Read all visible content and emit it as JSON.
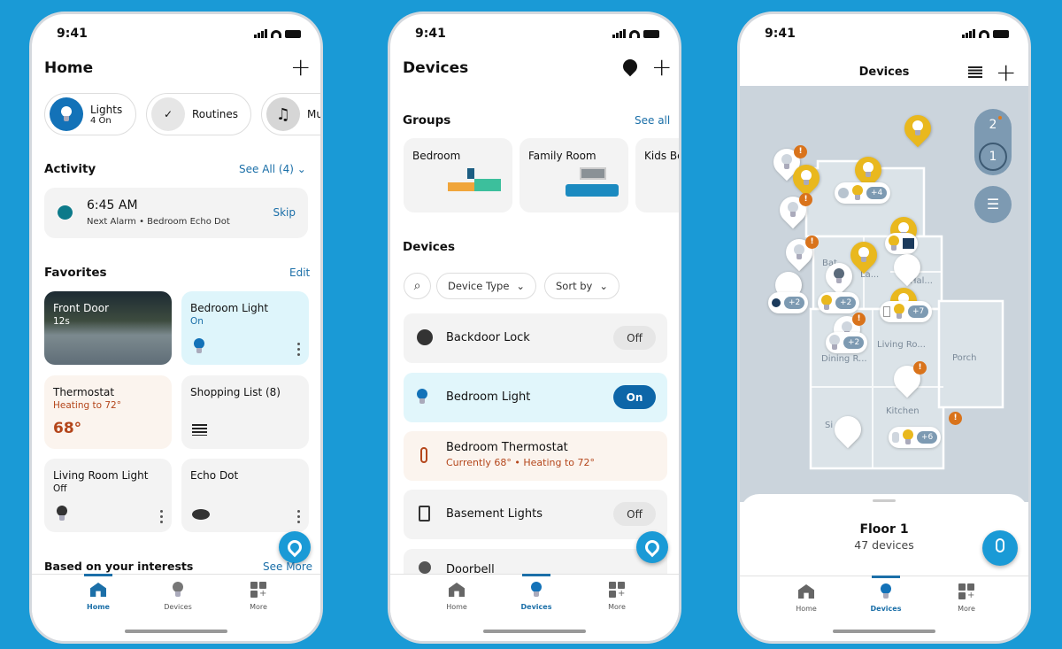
{
  "status": {
    "time": "9:41"
  },
  "home": {
    "title": "Home",
    "chips": [
      {
        "label": "Lights",
        "sub": "4 On",
        "icon": "bulb-icon"
      },
      {
        "label": "Routines",
        "icon": "routines-icon"
      },
      {
        "label": "Mu",
        "icon": "music-icon"
      }
    ],
    "activity": {
      "title": "Activity",
      "see_all": "See All (4)",
      "time": "6:45 AM",
      "desc": "Next Alarm • Bedroom Echo Dot",
      "action": "Skip"
    },
    "favorites": {
      "title": "Favorites",
      "edit": "Edit",
      "tiles": [
        {
          "title": "Front Door",
          "sub": "12s"
        },
        {
          "title": "Bedroom Light",
          "sub": "On"
        },
        {
          "title": "Thermostat",
          "sub": "Heating to 72°",
          "value": "68°"
        },
        {
          "title": "Shopping List (8)"
        },
        {
          "title": "Living Room Light",
          "sub": "Off"
        },
        {
          "title": "Echo Dot"
        }
      ]
    },
    "interests": {
      "title": "Based on your interests",
      "link": "See More"
    }
  },
  "devices": {
    "title": "Devices",
    "groups_title": "Groups",
    "see_all": "See all",
    "groups": [
      "Bedroom",
      "Family Room",
      "Kids Be"
    ],
    "devices_title": "Devices",
    "filters": {
      "type": "Device Type",
      "sort": "Sort by"
    },
    "rows": [
      {
        "name": "Backdoor Lock",
        "state": "Off"
      },
      {
        "name": "Bedroom Light",
        "state": "On"
      },
      {
        "name": "Bedroom Thermostat",
        "sub": "Currently 68° • Heating to 72°"
      },
      {
        "name": "Basement Lights",
        "state": "Off"
      },
      {
        "name": "Doorbell"
      }
    ]
  },
  "map": {
    "title": "Devices",
    "floors": [
      "2",
      "1"
    ],
    "rooms": [
      "Bat",
      "La...",
      "Hal...",
      "Living Ro...",
      "Dining R...",
      "Porch",
      "Kitchen",
      "Si"
    ],
    "clusters": [
      "+4",
      "+2",
      "+2",
      "+7",
      "+2",
      "+6"
    ],
    "sheet": {
      "floor": "Floor 1",
      "count": "47 devices"
    }
  },
  "tabs": [
    "Home",
    "Devices",
    "More"
  ],
  "colors": {
    "accent": "#1b6fa8",
    "background": "#1a9ad6",
    "thermo": "#b4461b",
    "bulb_on": "#e9b81e"
  }
}
